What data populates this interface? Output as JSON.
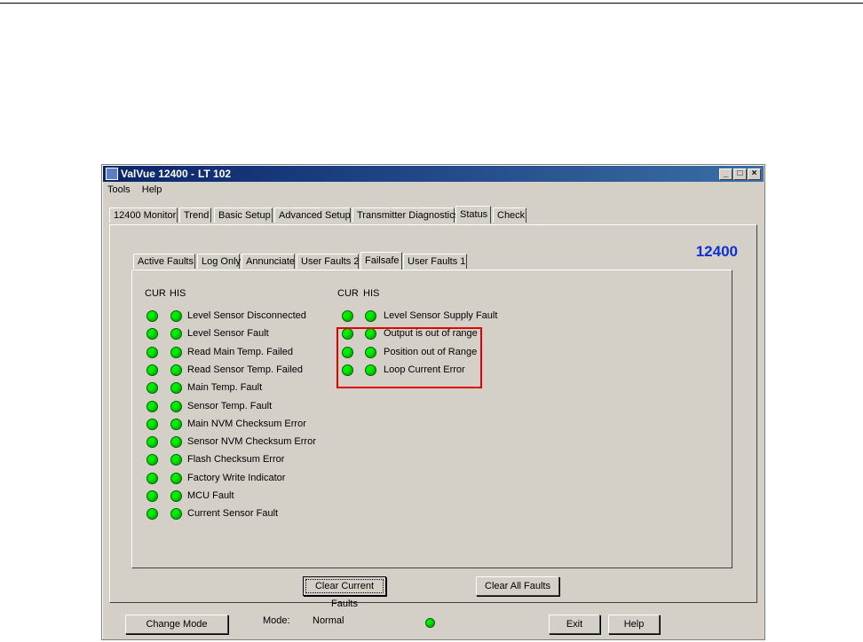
{
  "window": {
    "title": "ValVue 12400 -",
    "subtitle": "LT 102",
    "controls": {
      "minimize": "_",
      "maximize": "□",
      "close": "×"
    }
  },
  "menu": [
    "Tools",
    "Help"
  ],
  "main_tabs": [
    "12400 Monitor",
    "Trend",
    "Basic Setup",
    "Advanced Setup",
    "Transmitter Diagnostics",
    "Status",
    "Check"
  ],
  "active_main_tab": "Status",
  "device_label": "12400",
  "sub_tabs": [
    "Active Faults",
    "Log Only",
    "Annunciate",
    "User Faults 2",
    "Failsafe",
    "User Faults 1"
  ],
  "active_sub_tab": "Failsafe",
  "column_headers": {
    "cur": "CUR",
    "his": "HIS"
  },
  "left_faults": [
    "Level Sensor Disconnected",
    "Level Sensor Fault",
    "Read Main Temp. Failed",
    "Read Sensor Temp. Failed",
    "Main Temp. Fault",
    "Sensor Temp. Fault",
    "Main NVM Checksum Error",
    "Sensor NVM Checksum Error",
    "Flash Checksum Error",
    "Factory Write Indicator",
    "MCU Fault",
    "Current Sensor Fault"
  ],
  "right_faults": [
    "Level Sensor Supply Fault",
    "Output is out of range",
    "Position out of Range",
    "Loop Current Error"
  ],
  "buttons": {
    "clear_current": "Clear Current Faults",
    "clear_all": "Clear All Faults",
    "change_mode": "Change Mode",
    "exit": "Exit",
    "help": "Help"
  },
  "status": {
    "mode_label": "Mode:",
    "mode_value": "Normal"
  },
  "colors": {
    "led_ok": "#00ee00",
    "highlight_box": "#e00000",
    "device_label": "#1030d0"
  }
}
